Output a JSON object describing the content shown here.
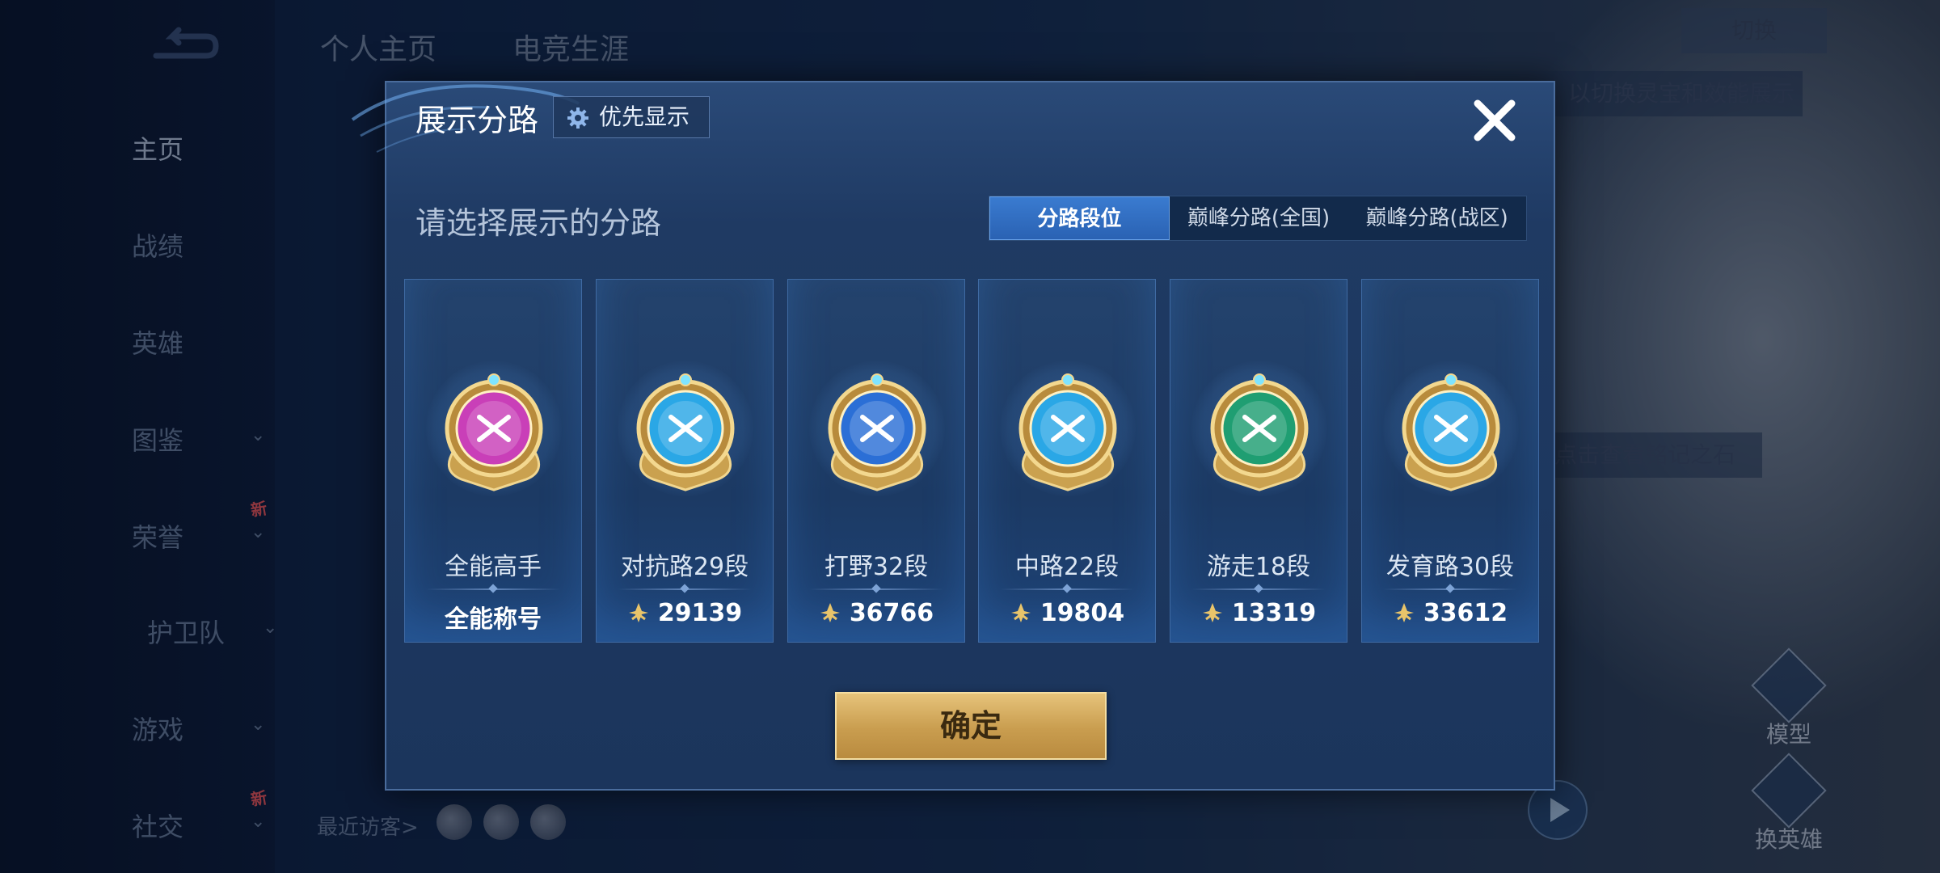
{
  "background": {
    "top_tabs": [
      "个人主页",
      "电竞生涯"
    ],
    "side_menu": [
      {
        "label": "主页",
        "active": true,
        "chevron": false,
        "new": false
      },
      {
        "label": "战绩",
        "active": false,
        "chevron": false,
        "new": false
      },
      {
        "label": "英雄",
        "active": false,
        "chevron": false,
        "new": false
      },
      {
        "label": "图鉴",
        "active": false,
        "chevron": true,
        "new": false
      },
      {
        "label": "荣誉",
        "active": false,
        "chevron": true,
        "new": true
      },
      {
        "label": "护卫队",
        "active": false,
        "chevron": true,
        "new": false
      },
      {
        "label": "游戏",
        "active": false,
        "chevron": true,
        "new": false
      },
      {
        "label": "社交",
        "active": false,
        "chevron": true,
        "new": true
      }
    ],
    "new_badge": "新",
    "recent_visitors_label": "最近访客>",
    "tip_text": "以切换灵宝和效能展示",
    "tip_text_2": "点击查看铭记之石",
    "top_right_button": "切换",
    "side_buttons": [
      "模型",
      "换英雄"
    ]
  },
  "dialog": {
    "title": "展示分路",
    "priority_button": "优先显示",
    "subtitle": "请选择展示的分路",
    "tabs": [
      {
        "label": "分路段位",
        "active": true
      },
      {
        "label": "巅峰分路(全国)",
        "active": false
      },
      {
        "label": "巅峰分路(战区)",
        "active": false
      }
    ],
    "cards": [
      {
        "name": "全能高手",
        "score": "全能称号",
        "has_points_icon": false,
        "emblem": "all-round-emblem-icon",
        "color": "#c93fb8"
      },
      {
        "name": "对抗路29段",
        "score": "29139",
        "has_points_icon": true,
        "emblem": "clash-lane-emblem-icon",
        "color": "#2aa7e6"
      },
      {
        "name": "打野32段",
        "score": "36766",
        "has_points_icon": true,
        "emblem": "jungle-emblem-icon",
        "color": "#2b6fd6"
      },
      {
        "name": "中路22段",
        "score": "19804",
        "has_points_icon": true,
        "emblem": "mid-lane-emblem-icon",
        "color": "#2aa7e6"
      },
      {
        "name": "游走18段",
        "score": "13319",
        "has_points_icon": true,
        "emblem": "roam-emblem-icon",
        "color": "#1f9e72"
      },
      {
        "name": "发育路30段",
        "score": "33612",
        "has_points_icon": true,
        "emblem": "farm-lane-emblem-icon",
        "color": "#2aa7e6"
      }
    ],
    "confirm_button": "确定"
  },
  "colors": {
    "dialog_bg": "#1f3a63",
    "tab_active": "#3a7bd0",
    "confirm_gold": "#d8b066",
    "gold_frame": "#e8c46a"
  }
}
